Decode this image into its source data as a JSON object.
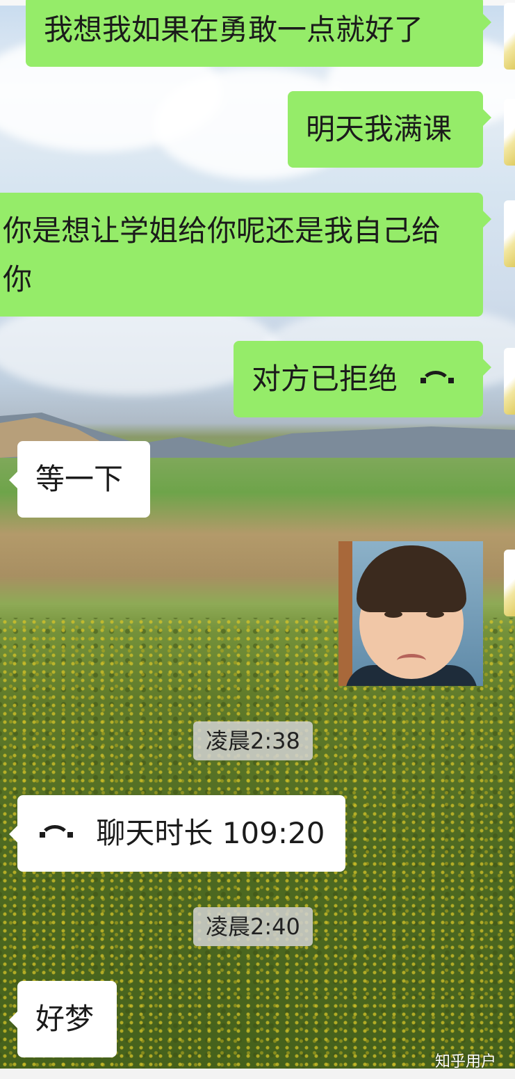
{
  "messages": [
    {
      "side": "out",
      "text": "我想我如果在勇敢一点就好了"
    },
    {
      "side": "out",
      "text": "明天我满课"
    },
    {
      "side": "out",
      "text": "你是想让学姐给你呢还是我自己给你"
    },
    {
      "side": "out",
      "text": "对方已拒绝",
      "icon": "phone-hangup-icon"
    },
    {
      "side": "in",
      "text": "等一下"
    },
    {
      "side": "out",
      "sticker": "crying-baby-sticker"
    },
    {
      "timestamp": "凌晨2:38"
    },
    {
      "side": "in",
      "text": "聊天时长 109:20",
      "icon": "phone-hangup-icon"
    },
    {
      "timestamp": "凌晨2:40"
    },
    {
      "side": "in",
      "text": "好梦"
    }
  ],
  "watermark": "知乎用户",
  "colors": {
    "outgoing": "#95ec69",
    "incoming": "#ffffff"
  }
}
